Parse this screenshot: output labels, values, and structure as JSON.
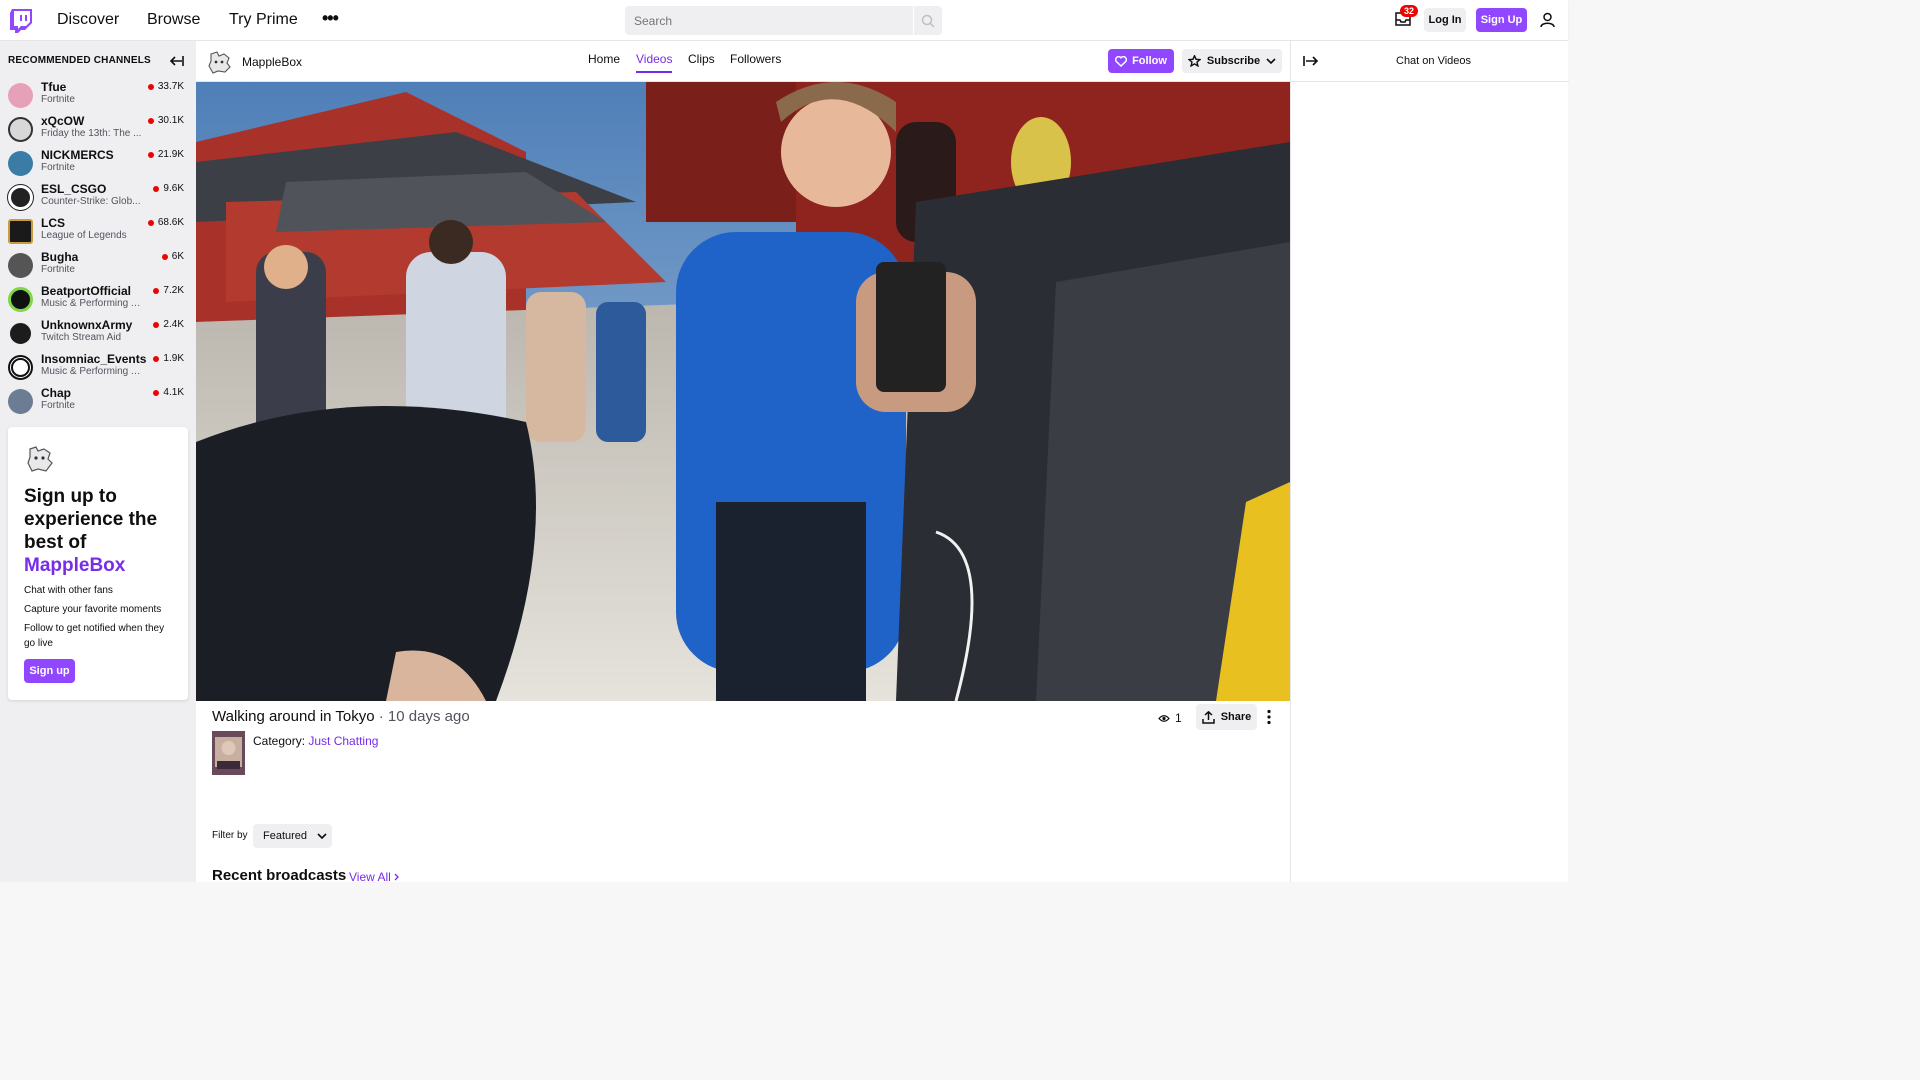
{
  "topnav": {
    "links": [
      "Discover",
      "Browse",
      "Try Prime"
    ],
    "more": "•••",
    "search_placeholder": "Search",
    "inbox_count": "32",
    "login_label": "Log In",
    "signup_label": "Sign Up"
  },
  "sidebar": {
    "heading": "RECOMMENDED CHANNELS",
    "channels": [
      {
        "name": "Tfue",
        "game": "Fortnite",
        "viewers": "33.7K"
      },
      {
        "name": "xQcOW",
        "game": "Friday the 13th: The ...",
        "viewers": "30.1K"
      },
      {
        "name": "NICKMERCS",
        "game": "Fortnite",
        "viewers": "21.9K"
      },
      {
        "name": "ESL_CSGO",
        "game": "Counter-Strike: Glob...",
        "viewers": "9.6K"
      },
      {
        "name": "LCS",
        "game": "League of Legends",
        "viewers": "68.6K"
      },
      {
        "name": "Bugha",
        "game": "Fortnite",
        "viewers": "6K"
      },
      {
        "name": "BeatportOfficial",
        "game": "Music & Performing A...",
        "viewers": "7.2K"
      },
      {
        "name": "UnknownxArmy",
        "game": "Twitch Stream Aid",
        "viewers": "2.4K"
      },
      {
        "name": "Insomniac_Events",
        "game": "Music & Performing A...",
        "viewers": "1.9K"
      },
      {
        "name": "Chap",
        "game": "Fortnite",
        "viewers": "4.1K"
      }
    ],
    "promo": {
      "title_prefix": "Sign up to experience the best of",
      "title_channel": "MappleBox",
      "lines": [
        "Chat with other fans",
        "Capture your favorite moments",
        "Follow to get notified when they go live"
      ],
      "button": "Sign up"
    }
  },
  "channel": {
    "name": "MappleBox",
    "tabs": [
      "Home",
      "Videos",
      "Clips",
      "Followers"
    ],
    "active_tab": "Videos",
    "follow_label": "Follow",
    "subscribe_label": "Subscribe"
  },
  "video": {
    "title": "Walking around in Tokyo",
    "age": " · 10 days ago",
    "category_label": "Category:",
    "category": "Just Chatting",
    "views": "1",
    "share_label": "Share"
  },
  "listing": {
    "filter_label": "Filter by",
    "filter_value": "Featured",
    "recent_title": "Recent broadcasts",
    "view_all": "View All"
  },
  "chat": {
    "title": "Chat on Videos"
  },
  "colors": {
    "accent": "#9147ff",
    "accent_text": "#772ce8",
    "live": "#eb0400"
  }
}
